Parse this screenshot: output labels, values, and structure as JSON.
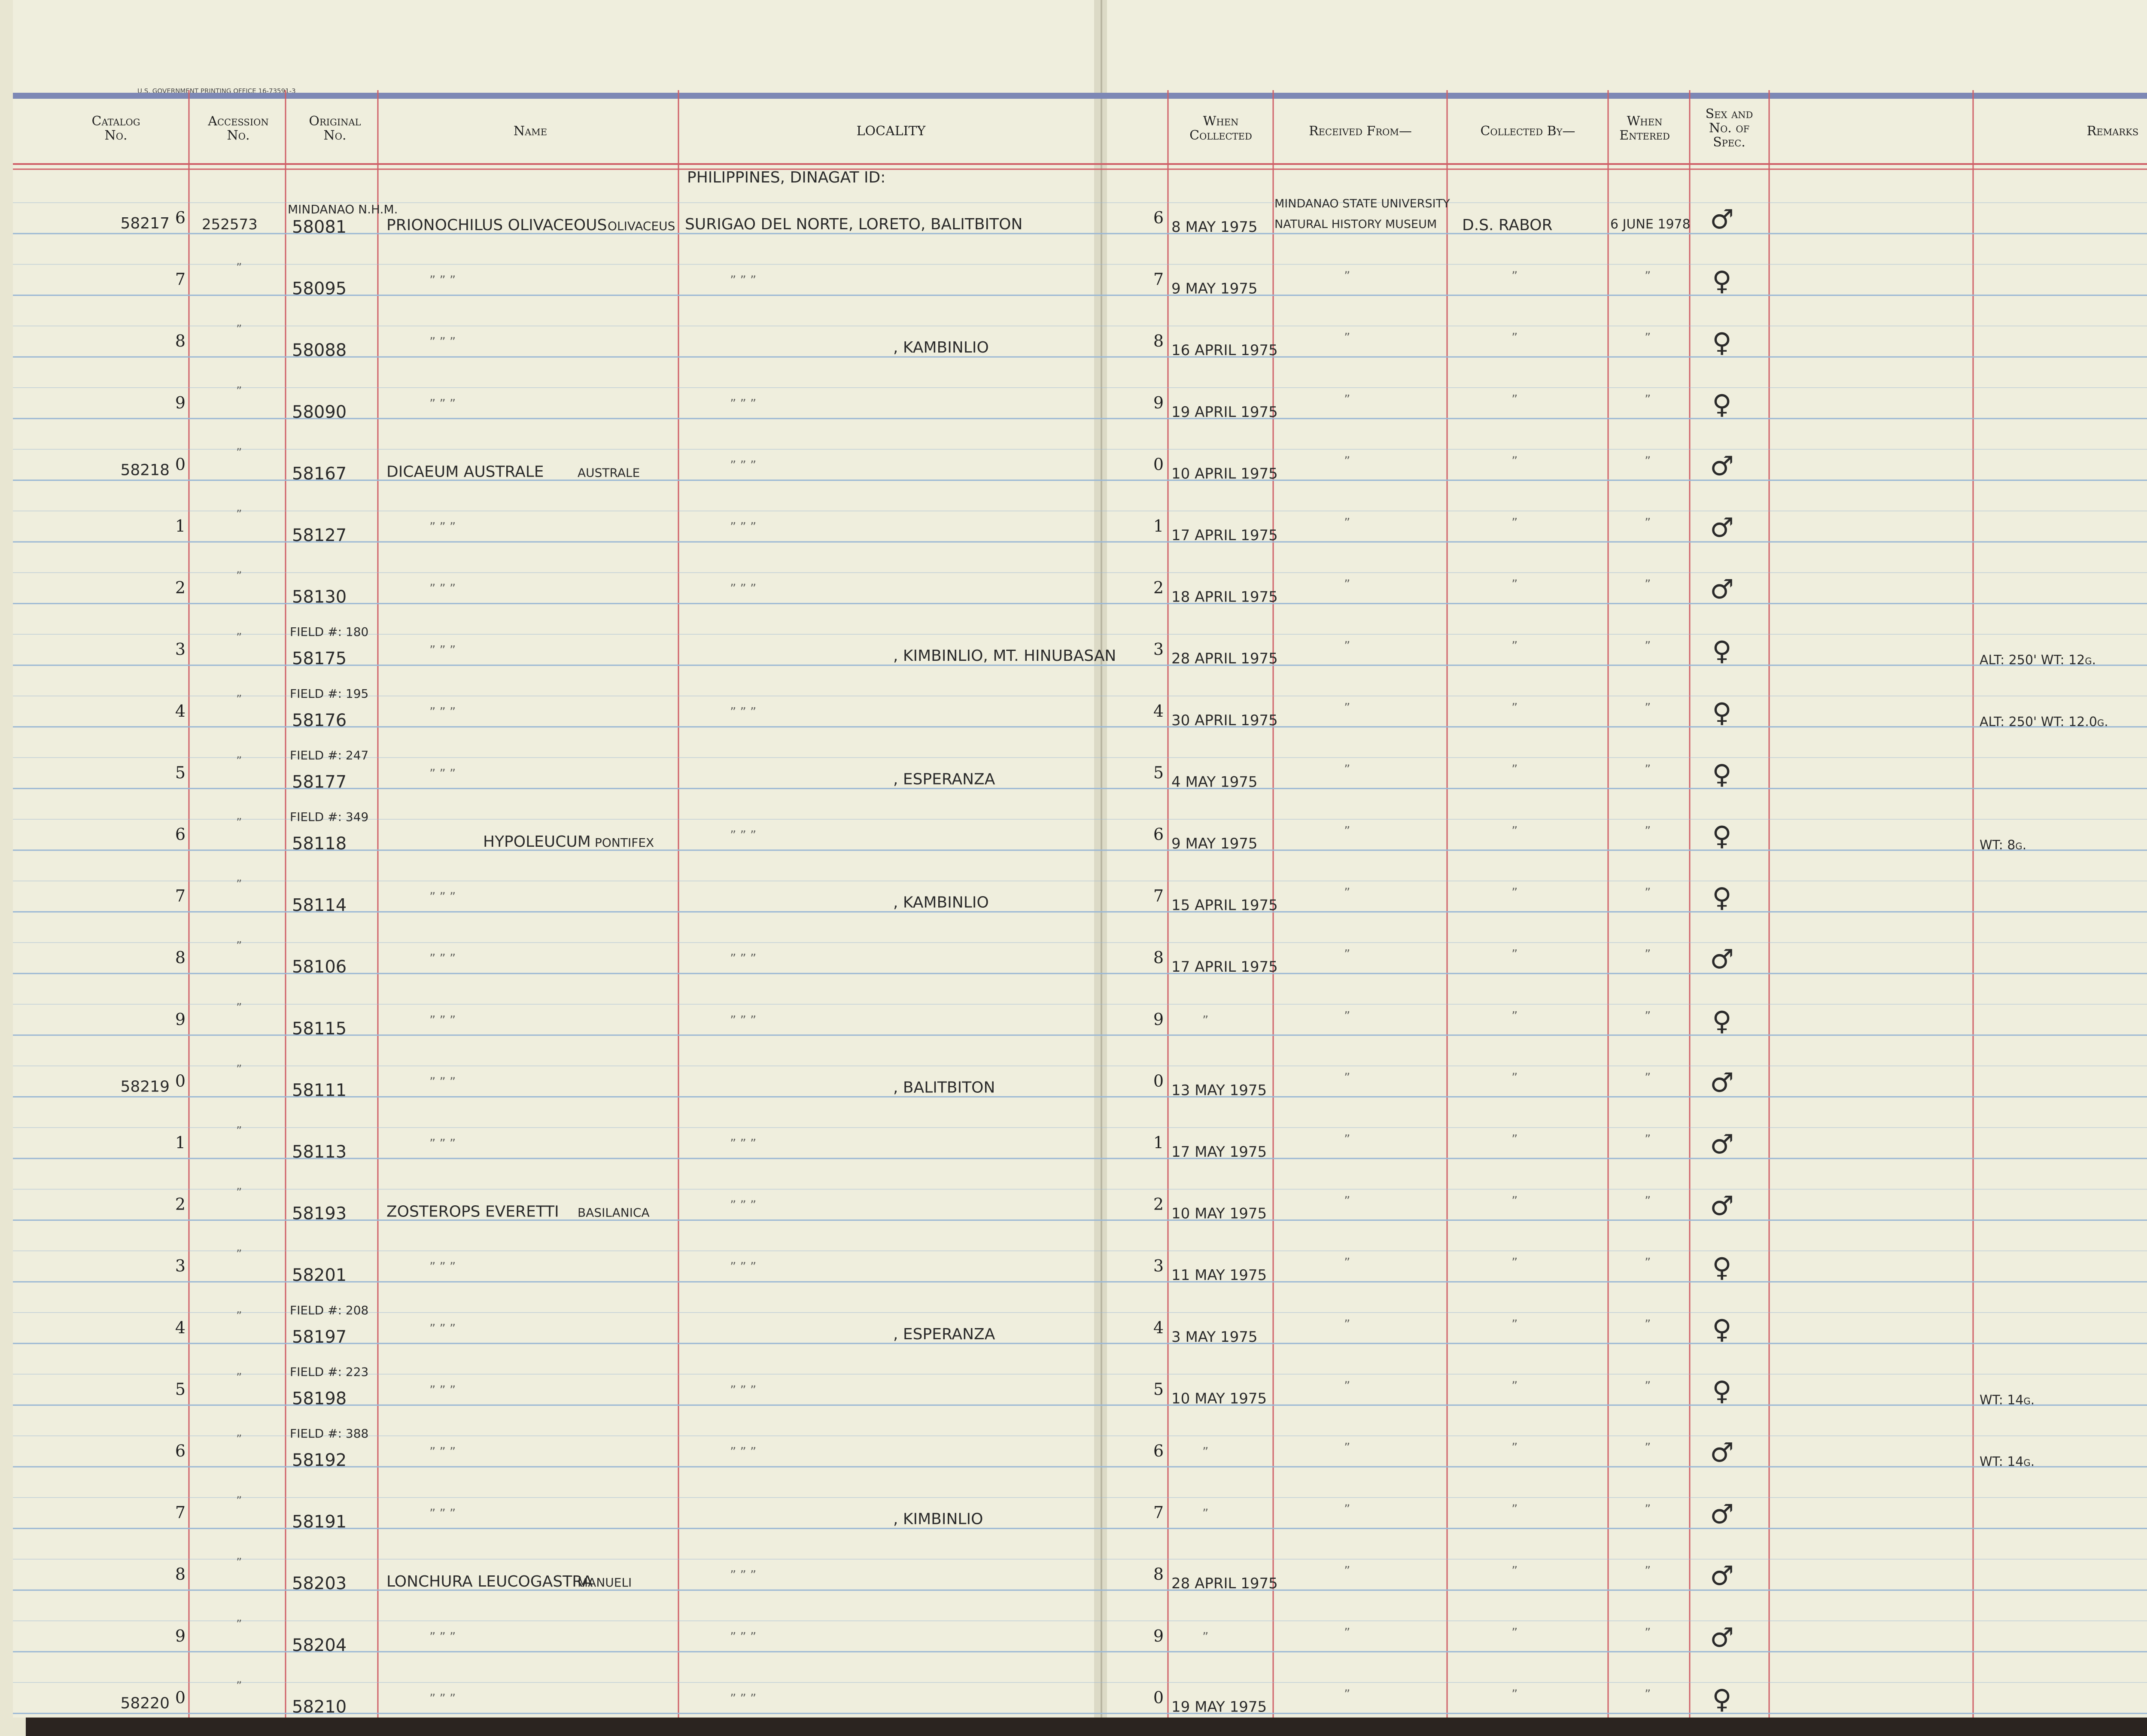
{
  "imprint": "U.S. GOVERNMENT PRINTING OFFICE 16-73591-3",
  "headers": {
    "catalog": [
      "Catalog",
      "No."
    ],
    "accession": [
      "Accession",
      "No."
    ],
    "original": [
      "Original",
      "No."
    ],
    "name": [
      "Name"
    ],
    "locality": [
      "LOCALITY"
    ],
    "when_collected": [
      "When",
      "Collected"
    ],
    "received_from": [
      "Received From—"
    ],
    "collected_by": [
      "Collected By—"
    ],
    "when_entered": [
      "When",
      "Entered"
    ],
    "sex": [
      "Sex and",
      "No. of",
      "Spec."
    ],
    "remarks": [
      "Remarks"
    ]
  },
  "top_notes": {
    "original_prefix": "MINDANAO N.H.M.",
    "locality_heading": "PHILIPPINES, DINAGAT ID:",
    "received_line1": "MINDANAO STATE UNIVERSITY",
    "received_line2": "NATURAL HISTORY MUSEUM"
  },
  "rows": [
    {
      "catalog": "58217",
      "digit": "6",
      "accession": "252573",
      "field": "",
      "original": "58081",
      "name": "PRIONOCHILUS OLIVACEOUS",
      "subspecies": "OLIVACEUS",
      "locality": "SURIGAO DEL NORTE, LORETO, BALITBITON",
      "when": "8 MAY 1975",
      "collector": "D.S. RABOR",
      "entered": "6 JUNE 1978",
      "sex": "♂",
      "remarks": ""
    },
    {
      "catalog": "",
      "digit": "7",
      "accession": "",
      "field": "",
      "original": "58095",
      "name": "",
      "subspecies": "",
      "locality": "",
      "when": "9 MAY 1975",
      "collector": "",
      "entered": "",
      "sex": "♀",
      "remarks": ""
    },
    {
      "catalog": "",
      "digit": "8",
      "accession": "",
      "field": "",
      "original": "58088",
      "name": "",
      "subspecies": "",
      "locality": ", KAMBINLIO",
      "when": "16 APRIL 1975",
      "collector": "",
      "entered": "",
      "sex": "♀",
      "remarks": ""
    },
    {
      "catalog": "",
      "digit": "9",
      "accession": "",
      "field": "",
      "original": "58090",
      "name": "",
      "subspecies": "",
      "locality": "",
      "when": "19 APRIL 1975",
      "collector": "",
      "entered": "",
      "sex": "♀",
      "remarks": ""
    },
    {
      "catalog": "58218",
      "digit": "0",
      "accession": "",
      "field": "",
      "original": "58167",
      "name": "DICAEUM AUSTRALE",
      "subspecies": "AUSTRALE",
      "locality": "",
      "when": "10 APRIL 1975",
      "collector": "",
      "entered": "",
      "sex": "♂",
      "remarks": ""
    },
    {
      "catalog": "",
      "digit": "1",
      "accession": "",
      "field": "",
      "original": "58127",
      "name": "",
      "subspecies": "",
      "locality": "",
      "when": "17 APRIL 1975",
      "collector": "",
      "entered": "",
      "sex": "♂",
      "remarks": ""
    },
    {
      "catalog": "",
      "digit": "2",
      "accession": "",
      "field": "",
      "original": "58130",
      "name": "",
      "subspecies": "",
      "locality": "",
      "when": "18 APRIL 1975",
      "collector": "",
      "entered": "",
      "sex": "♂",
      "remarks": ""
    },
    {
      "catalog": "",
      "digit": "3",
      "accession": "",
      "field": "FIELD #: 180",
      "original": "58175",
      "name": "",
      "subspecies": "",
      "locality": ", KIMBINLIO, MT. HINUBASAN",
      "when": "28 APRIL 1975",
      "collector": "",
      "entered": "",
      "sex": "♀",
      "remarks": "ALT: 250'  WT: 12g."
    },
    {
      "catalog": "",
      "digit": "4",
      "accession": "",
      "field": "FIELD #: 195",
      "original": "58176",
      "name": "",
      "subspecies": "",
      "locality": "",
      "when": "30 APRIL 1975",
      "collector": "",
      "entered": "",
      "sex": "♀",
      "remarks": "ALT: 250'  WT: 12.0g."
    },
    {
      "catalog": "",
      "digit": "5",
      "accession": "",
      "field": "FIELD #: 247",
      "original": "58177",
      "name": "",
      "subspecies": "",
      "locality": ", ESPERANZA",
      "when": "4 MAY 1975",
      "collector": "",
      "entered": "",
      "sex": "♀",
      "remarks": ""
    },
    {
      "catalog": "",
      "digit": "6",
      "accession": "",
      "field": "FIELD #: 349",
      "original": "58118",
      "name": "HYPOLEUCUM",
      "subspecies": "PONTIFEX",
      "locality": "",
      "when": "9 MAY 1975",
      "collector": "",
      "entered": "",
      "sex": "♀",
      "remarks": "WT: 8g."
    },
    {
      "catalog": "",
      "digit": "7",
      "accession": "",
      "field": "",
      "original": "58114",
      "name": "",
      "subspecies": "",
      "locality": ", KAMBINLIO",
      "when": "15 APRIL 1975",
      "collector": "",
      "entered": "",
      "sex": "♀",
      "remarks": ""
    },
    {
      "catalog": "",
      "digit": "8",
      "accession": "",
      "field": "",
      "original": "58106",
      "name": "",
      "subspecies": "",
      "locality": "",
      "when": "17 APRIL 1975",
      "collector": "",
      "entered": "",
      "sex": "♂",
      "remarks": ""
    },
    {
      "catalog": "",
      "digit": "9",
      "accession": "",
      "field": "",
      "original": "58115",
      "name": "",
      "subspecies": "",
      "locality": "",
      "when": "",
      "collector": "",
      "entered": "",
      "sex": "♀",
      "remarks": ""
    },
    {
      "catalog": "58219",
      "digit": "0",
      "accession": "",
      "field": "",
      "original": "58111",
      "name": "",
      "subspecies": "",
      "locality": ", BALITBITON",
      "when": "13 MAY 1975",
      "collector": "",
      "entered": "",
      "sex": "♂",
      "remarks": ""
    },
    {
      "catalog": "",
      "digit": "1",
      "accession": "",
      "field": "",
      "original": "58113",
      "name": "",
      "subspecies": "",
      "locality": "",
      "when": "17 MAY 1975",
      "collector": "",
      "entered": "",
      "sex": "♂",
      "remarks": ""
    },
    {
      "catalog": "",
      "digit": "2",
      "accession": "",
      "field": "",
      "original": "58193",
      "name": "ZOSTEROPS EVERETTI",
      "subspecies": "BASILANICA",
      "locality": "",
      "when": "10 MAY 1975",
      "collector": "",
      "entered": "",
      "sex": "♂",
      "remarks": ""
    },
    {
      "catalog": "",
      "digit": "3",
      "accession": "",
      "field": "",
      "original": "58201",
      "name": "",
      "subspecies": "",
      "locality": "",
      "when": "11 MAY 1975",
      "collector": "",
      "entered": "",
      "sex": "♀",
      "remarks": ""
    },
    {
      "catalog": "",
      "digit": "4",
      "accession": "",
      "field": "FIELD #: 208",
      "original": "58197",
      "name": "",
      "subspecies": "",
      "locality": ", ESPERANZA",
      "when": "3 MAY 1975",
      "collector": "",
      "entered": "",
      "sex": "♀",
      "remarks": ""
    },
    {
      "catalog": "",
      "digit": "5",
      "accession": "",
      "field": "FIELD #: 223",
      "original": "58198",
      "name": "",
      "subspecies": "",
      "locality": "",
      "when": "10 MAY 1975",
      "collector": "",
      "entered": "",
      "sex": "♀",
      "remarks": "WT: 14g."
    },
    {
      "catalog": "",
      "digit": "6",
      "accession": "",
      "field": "FIELD #: 388",
      "original": "58192",
      "name": "",
      "subspecies": "",
      "locality": "",
      "when": "",
      "collector": "",
      "entered": "",
      "sex": "♂",
      "remarks": "WT: 14g."
    },
    {
      "catalog": "",
      "digit": "7",
      "accession": "",
      "field": "",
      "original": "58191",
      "name": "",
      "subspecies": "",
      "locality": ", KIMBINLIO",
      "when": "",
      "collector": "",
      "entered": "",
      "sex": "♂",
      "remarks": ""
    },
    {
      "catalog": "",
      "digit": "8",
      "accession": "",
      "field": "",
      "original": "58203",
      "name": "LONCHURA LEUCOGASTRA",
      "subspecies": "MANUELI",
      "locality": "",
      "when": "28 APRIL 1975",
      "collector": "",
      "entered": "",
      "sex": "♂",
      "remarks": ""
    },
    {
      "catalog": "",
      "digit": "9",
      "accession": "",
      "field": "",
      "original": "58204",
      "name": "",
      "subspecies": "",
      "locality": "",
      "when": "",
      "collector": "",
      "entered": "",
      "sex": "♂",
      "remarks": ""
    },
    {
      "catalog": "58220",
      "digit": "0",
      "accession": "",
      "field": "",
      "original": "58210",
      "name": "",
      "subspecies": "",
      "locality": "",
      "when": "19 MAY 1975",
      "collector": "",
      "entered": "",
      "sex": "♀",
      "remarks": ""
    }
  ],
  "colors": {
    "paper": "#efeedd",
    "red_rule": "#cf6068",
    "blue_rule": "#9ab7d4",
    "ink": "#2a2a2a",
    "cover": "#2b2420"
  }
}
